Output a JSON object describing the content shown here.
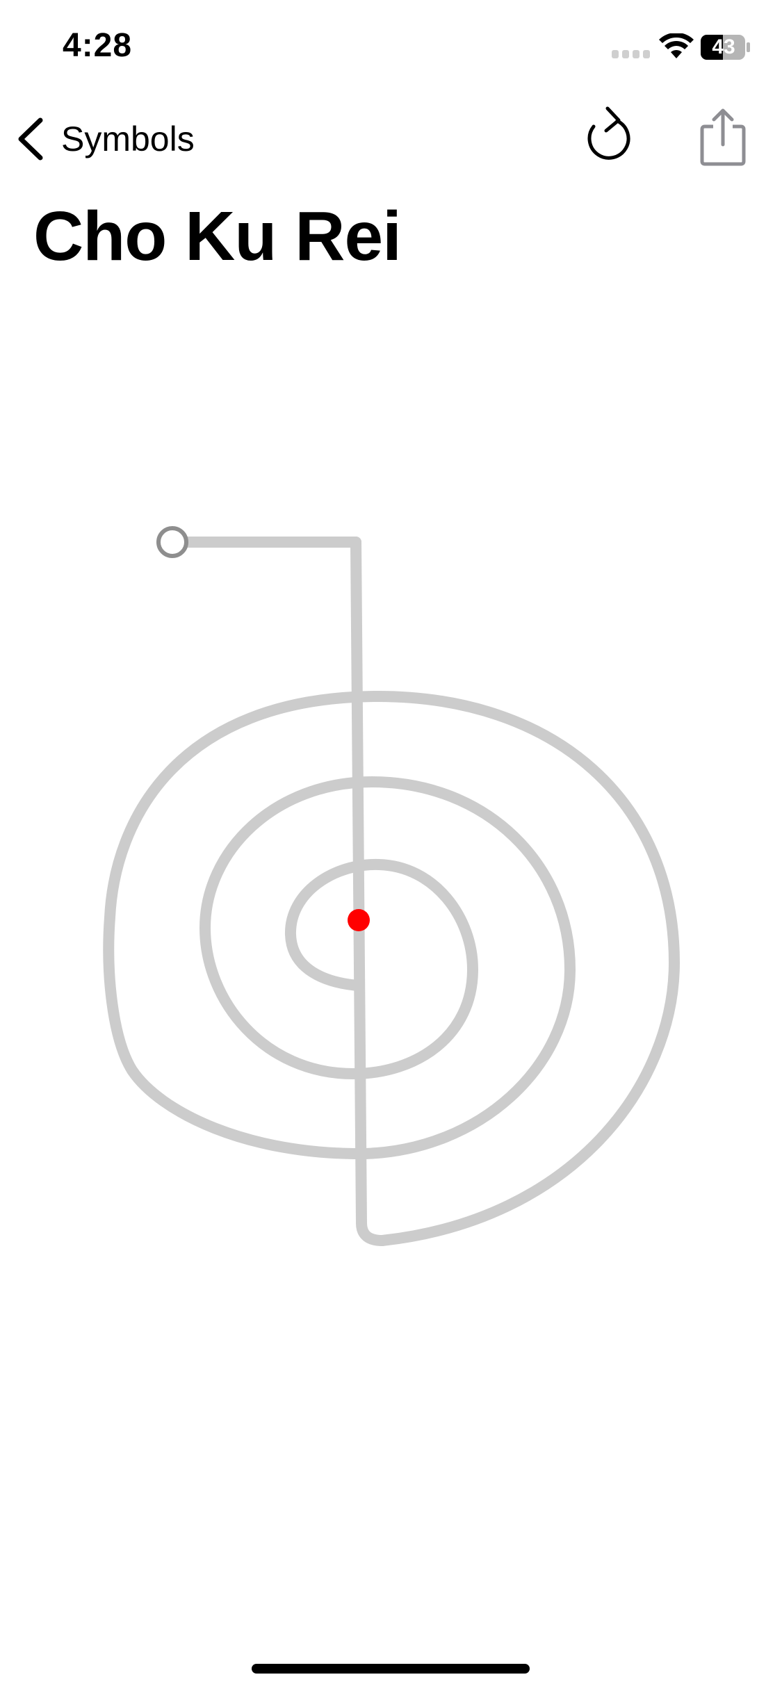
{
  "status_bar": {
    "time": "4:28",
    "battery_level": "43",
    "icons": [
      "cellular-signal-icon",
      "wifi-icon",
      "battery-icon"
    ]
  },
  "nav": {
    "back_label": "Symbols",
    "back_icon": "chevron-left-icon",
    "reload_icon": "reload-icon",
    "share_icon": "share-icon"
  },
  "title": "Cho Ku Rei",
  "symbol": {
    "stroke_color": "#cccccc",
    "start_marker_color": "#8e8e8e",
    "current_point_color": "#ff0000"
  },
  "colors": {
    "background": "#ffffff",
    "text": "#000000",
    "icon_gray": "#8e8e93"
  }
}
